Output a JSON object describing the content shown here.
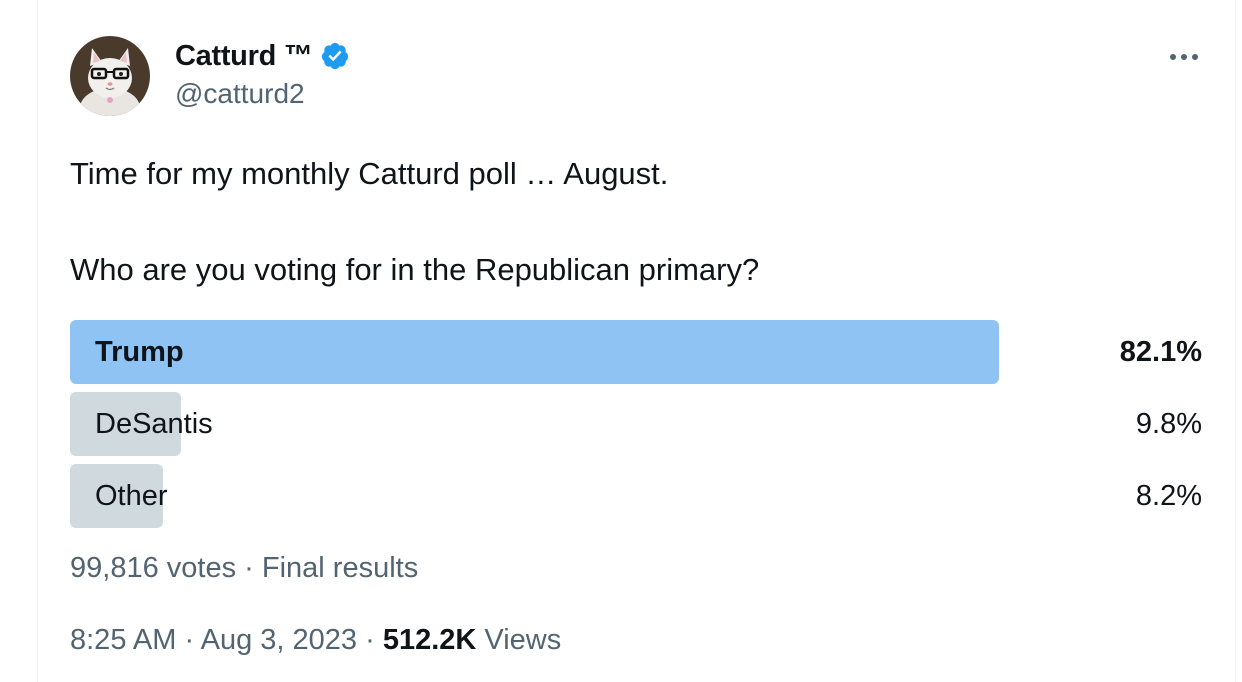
{
  "author": {
    "display_name": "Catturd ™",
    "handle": "@catturd2",
    "verified": true,
    "verified_color": "#1d9bf0",
    "avatar_icon": "cat-with-glasses-avatar"
  },
  "actions": {
    "more_icon": "more-horizontal-icon"
  },
  "tweet": {
    "line1": "Time for my monthly Catturd poll … August.",
    "line2": "Who are you voting for in the Republican primary?"
  },
  "poll": {
    "winner_color": "#8ec3f3",
    "loser_color": "#cfd9de",
    "options": [
      {
        "label": "Trump",
        "percent": "82.1%",
        "share": 0.821,
        "winner": true
      },
      {
        "label": "DeSantis",
        "percent": "9.8%",
        "share": 0.098,
        "winner": false
      },
      {
        "label": "Other",
        "percent": "8.2%",
        "share": 0.082,
        "winner": false
      }
    ],
    "votes": "99,816 votes",
    "separator": "·",
    "status": "Final results"
  },
  "meta": {
    "time": "8:25 AM",
    "separator": "·",
    "date": "Aug 3, 2023",
    "views_count": "512.2K",
    "views_label": "Views"
  }
}
